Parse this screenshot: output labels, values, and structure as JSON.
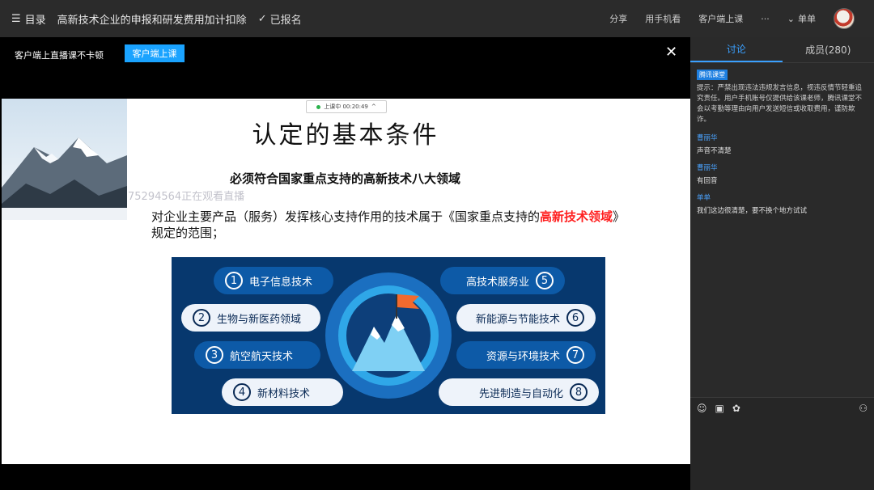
{
  "topbar": {
    "menu_label": "目录",
    "course_title": "高新技术企业的申报和研发费用加计扣除",
    "signed_label": "已报名",
    "share": "分享",
    "mobile": "用手机看",
    "client": "客户端上课",
    "more": "···",
    "user": "单单"
  },
  "video": {
    "notice": "客户端上直播课不卡顿",
    "notice_button": "客户端上课",
    "close": "✕"
  },
  "slide": {
    "timer": "上课中 00:20:49",
    "title": "认定的基本条件",
    "watermark": "75294564正在观看直播",
    "subtitle": "必须符合国家重点支持的高新技术八大领域",
    "body_pre": "对企业主要产品（服务）发挥核心支持作用的技术属于《国家重点支持的",
    "body_highlight": "高新技术领域",
    "body_post": "》规定的范围；",
    "fields": [
      {
        "num": "1",
        "label": "电子信息技术"
      },
      {
        "num": "2",
        "label": "生物与新医药领域"
      },
      {
        "num": "3",
        "label": "航空航天技术"
      },
      {
        "num": "4",
        "label": "新材料技术"
      },
      {
        "num": "5",
        "label": "高技术服务业"
      },
      {
        "num": "6",
        "label": "新能源与节能技术"
      },
      {
        "num": "7",
        "label": "资源与环境技术"
      },
      {
        "num": "8",
        "label": "先进制造与自动化"
      }
    ]
  },
  "panel": {
    "tab_discuss": "讨论",
    "tab_members": "成员(280)",
    "sys_badge": "腾讯课堂",
    "sys_msg": "提示：严禁出现违法违规发言信息，视违反情节轻重追究责任。用户手机账号仅提供给该课老师，腾讯课堂不会以考勤等理由向用户发送短信或收取费用，谨防欺诈。",
    "messages": [
      {
        "who": "曹丽华",
        "text": "声音不清楚"
      },
      {
        "who": "曹丽华",
        "text": "有回音"
      },
      {
        "who": "单单",
        "text": "我们这边很清楚，要不换个地方试试"
      }
    ]
  },
  "colors": {
    "accent": "#3aa0ff",
    "highlight": "#ff2020",
    "diagram_bg": "#07386e"
  }
}
